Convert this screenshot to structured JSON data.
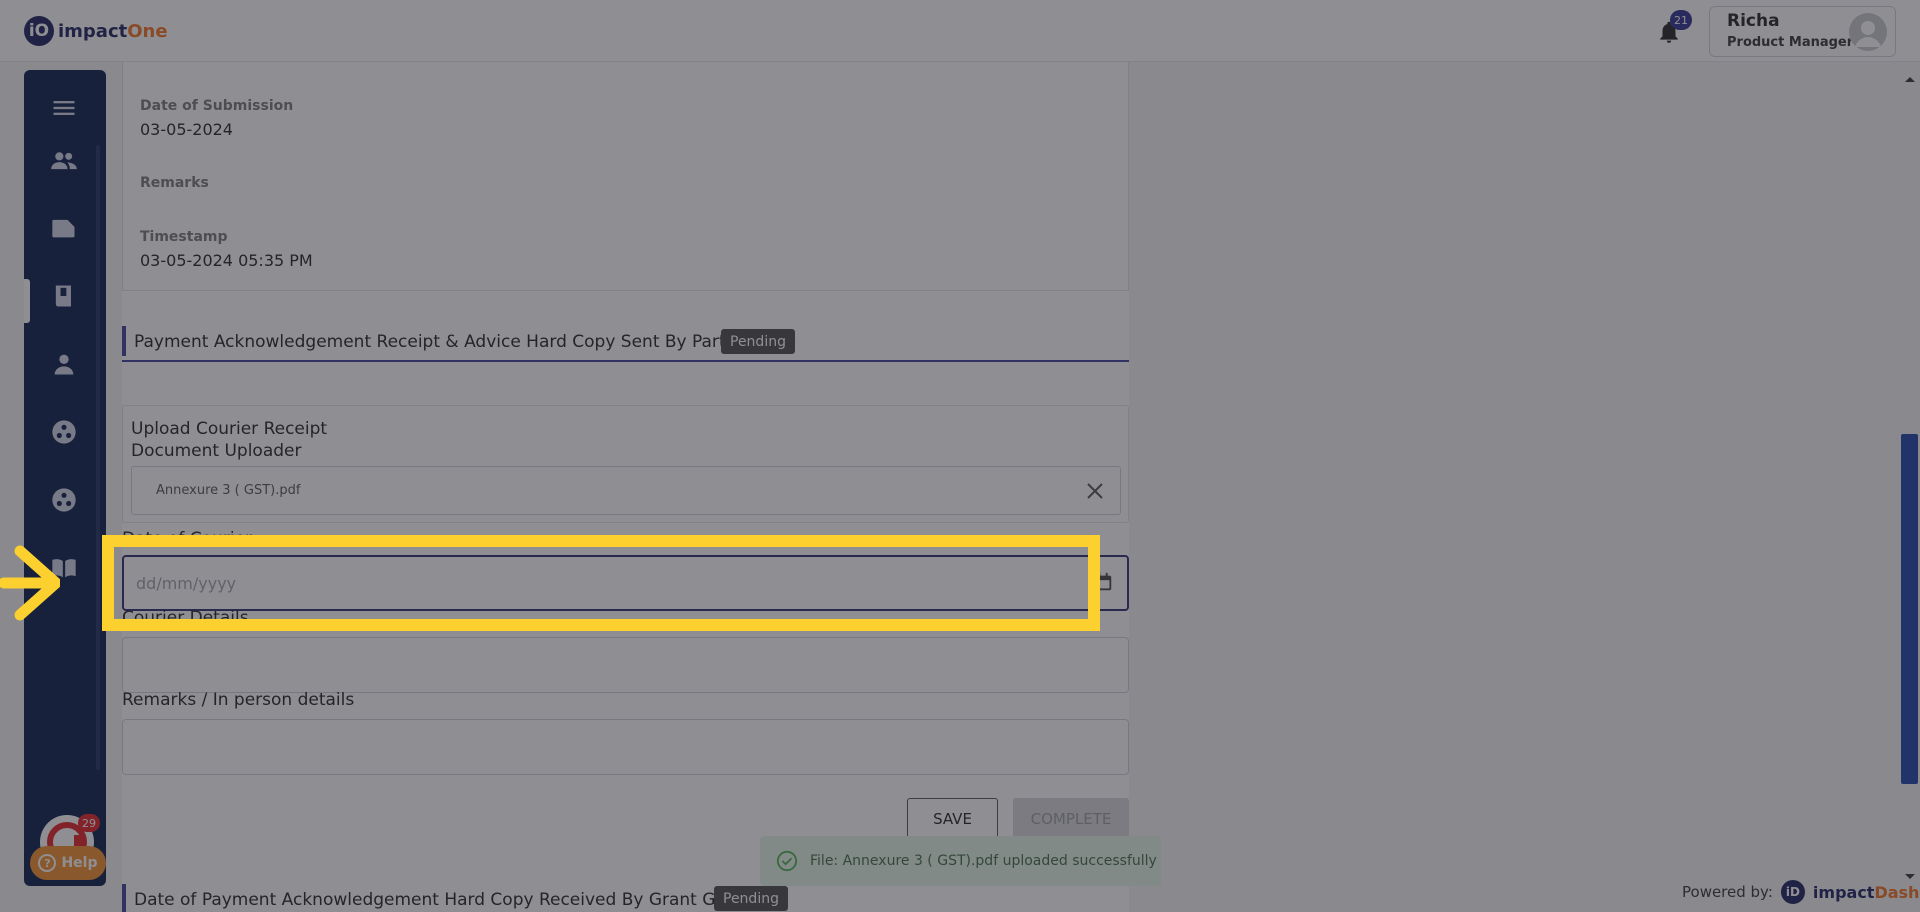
{
  "header": {
    "logo_mark": "iO",
    "logo_main": "impact",
    "logo_accent": "One",
    "notifications_count": "21",
    "user_name": "Richa",
    "user_role": "Product Manager"
  },
  "sidebar": {
    "icons": [
      "menu-icon",
      "people-icon",
      "folder-icon",
      "book-icon",
      "person-icon",
      "hub-icon",
      "hub-alt-icon",
      "manual-icon"
    ],
    "assistant_badge": "29",
    "help_label": "Help",
    "help_glyph": "?"
  },
  "details": {
    "submission_label": "Date of Submission",
    "submission_value": "03-05-2024",
    "remarks_label": "Remarks",
    "timestamp_label": "Timestamp",
    "timestamp_value": "03-05-2024 05:35 PM"
  },
  "section": {
    "title": "Payment Acknowledgement Receipt & Advice Hard Copy Sent By Partner",
    "status": "Pending"
  },
  "upload": {
    "title": "Upload Courier Receipt",
    "subtitle": "Document Uploader",
    "file_name": "Annexure 3 ( GST).pdf"
  },
  "form": {
    "date_label": "Date of Courier",
    "date_placeholder": "dd/mm/yyyy",
    "courier_label": "Courier Details",
    "remarks_label": "Remarks / In person details",
    "save_label": "SAVE",
    "complete_label": "COMPLETE"
  },
  "next_section": {
    "title": "Date of Payment Acknowledgement Hard Copy Received By Grant Giver",
    "status": "Pending"
  },
  "toast": {
    "message": "File: Annexure 3 ( GST).pdf uploaded successfully"
  },
  "footer": {
    "powered_label": "Powered by:",
    "brand_mark": "iD",
    "brand_main": "impact",
    "brand_accent": "Dash"
  },
  "colors": {
    "sidebar_bg": "#071a4a",
    "accent_purple": "#2b2a73",
    "highlight": "#fcd12f",
    "brand_orange": "#f26f21"
  }
}
